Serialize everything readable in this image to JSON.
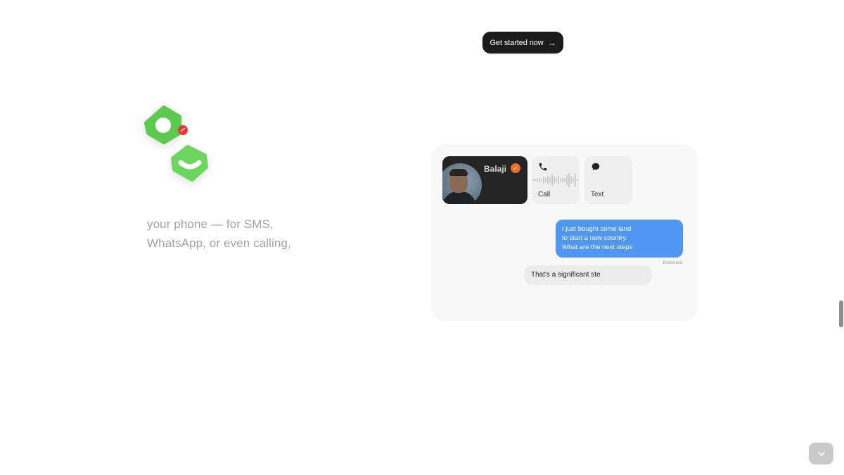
{
  "header": {
    "cta_label": "Get started now",
    "cta_icon": "arrow-right-icon"
  },
  "hero": {
    "tagline_lines": [
      "your phone — for SMS,",
      "WhatsApp, or even calling,"
    ]
  },
  "demo": {
    "contact": {
      "name": "Balaji",
      "verified_icon": "check-badge-icon"
    },
    "actions": [
      {
        "label": "Call",
        "icon": "phone-icon"
      },
      {
        "label": "Text",
        "icon": "chat-bubble-icon"
      }
    ],
    "messages": {
      "outgoing_lines": [
        "I just bought some land",
        "to start a new country.",
        "What are the next steps"
      ],
      "status": "Delivered",
      "incoming": "That's a significant ste"
    }
  },
  "colors": {
    "brand_green": "#5cc94f",
    "outgoing_bubble": "#4f97f2",
    "verified_badge": "#f06a2a",
    "notification_dot": "#e53935"
  }
}
